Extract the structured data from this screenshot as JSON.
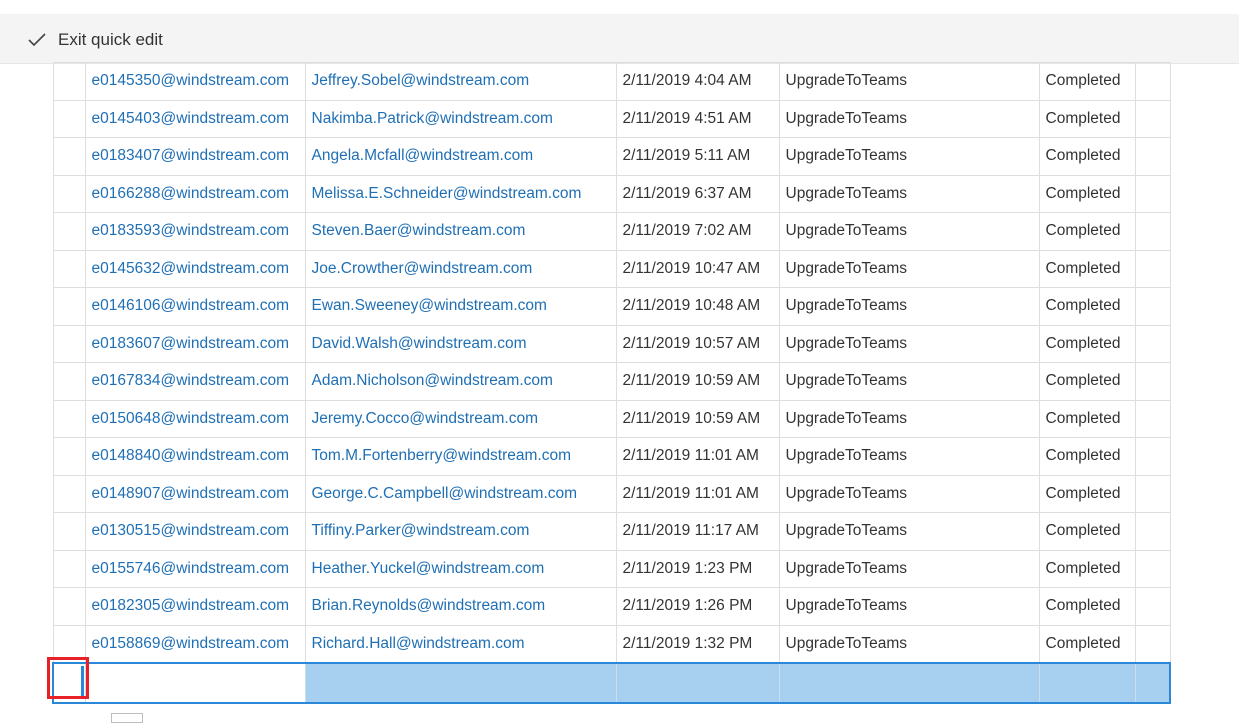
{
  "toolbar": {
    "exit_label": "Exit quick edit",
    "exit_icon": "checkmark-icon"
  },
  "grid": {
    "rows": [
      {
        "user": "e0145350@windstream.com",
        "email": "Jeffrey.Sobel@windstream.com",
        "date": "2/11/2019 4:04 AM",
        "action": "UpgradeToTeams",
        "status": "Completed"
      },
      {
        "user": "e0145403@windstream.com",
        "email": "Nakimba.Patrick@windstream.com",
        "date": "2/11/2019 4:51 AM",
        "action": "UpgradeToTeams",
        "status": "Completed"
      },
      {
        "user": "e0183407@windstream.com",
        "email": "Angela.Mcfall@windstream.com",
        "date": "2/11/2019 5:11 AM",
        "action": "UpgradeToTeams",
        "status": "Completed"
      },
      {
        "user": "e0166288@windstream.com",
        "email": "Melissa.E.Schneider@windstream.com",
        "date": "2/11/2019 6:37 AM",
        "action": "UpgradeToTeams",
        "status": "Completed"
      },
      {
        "user": "e0183593@windstream.com",
        "email": "Steven.Baer@windstream.com",
        "date": "2/11/2019 7:02 AM",
        "action": "UpgradeToTeams",
        "status": "Completed"
      },
      {
        "user": "e0145632@windstream.com",
        "email": "Joe.Crowther@windstream.com",
        "date": "2/11/2019 10:47 AM",
        "action": "UpgradeToTeams",
        "status": "Completed"
      },
      {
        "user": "e0146106@windstream.com",
        "email": "Ewan.Sweeney@windstream.com",
        "date": "2/11/2019 10:48 AM",
        "action": "UpgradeToTeams",
        "status": "Completed"
      },
      {
        "user": "e0183607@windstream.com",
        "email": "David.Walsh@windstream.com",
        "date": "2/11/2019 10:57 AM",
        "action": "UpgradeToTeams",
        "status": "Completed"
      },
      {
        "user": "e0167834@windstream.com",
        "email": "Adam.Nicholson@windstream.com",
        "date": "2/11/2019 10:59 AM",
        "action": "UpgradeToTeams",
        "status": "Completed"
      },
      {
        "user": "e0150648@windstream.com",
        "email": "Jeremy.Cocco@windstream.com",
        "date": "2/11/2019 10:59 AM",
        "action": "UpgradeToTeams",
        "status": "Completed"
      },
      {
        "user": "e0148840@windstream.com",
        "email": "Tom.M.Fortenberry@windstream.com",
        "date": "2/11/2019 11:01 AM",
        "action": "UpgradeToTeams",
        "status": "Completed"
      },
      {
        "user": "e0148907@windstream.com",
        "email": "George.C.Campbell@windstream.com",
        "date": "2/11/2019 11:01 AM",
        "action": "UpgradeToTeams",
        "status": "Completed"
      },
      {
        "user": "e0130515@windstream.com",
        "email": "Tiffiny.Parker@windstream.com",
        "date": "2/11/2019 11:17 AM",
        "action": "UpgradeToTeams",
        "status": "Completed"
      },
      {
        "user": "e0155746@windstream.com",
        "email": "Heather.Yuckel@windstream.com",
        "date": "2/11/2019 1:23 PM",
        "action": "UpgradeToTeams",
        "status": "Completed"
      },
      {
        "user": "e0182305@windstream.com",
        "email": "Brian.Reynolds@windstream.com",
        "date": "2/11/2019 1:26 PM",
        "action": "UpgradeToTeams",
        "status": "Completed"
      },
      {
        "user": "e0158869@windstream.com",
        "email": "Richard.Hall@windstream.com",
        "date": "2/11/2019 1:32 PM",
        "action": "UpgradeToTeams",
        "status": "Completed"
      }
    ]
  },
  "colors": {
    "link": "#1f6fb5",
    "selection_fill": "#a7d0f0",
    "selection_border": "#2b88d8",
    "highlight": "#e8202a"
  }
}
